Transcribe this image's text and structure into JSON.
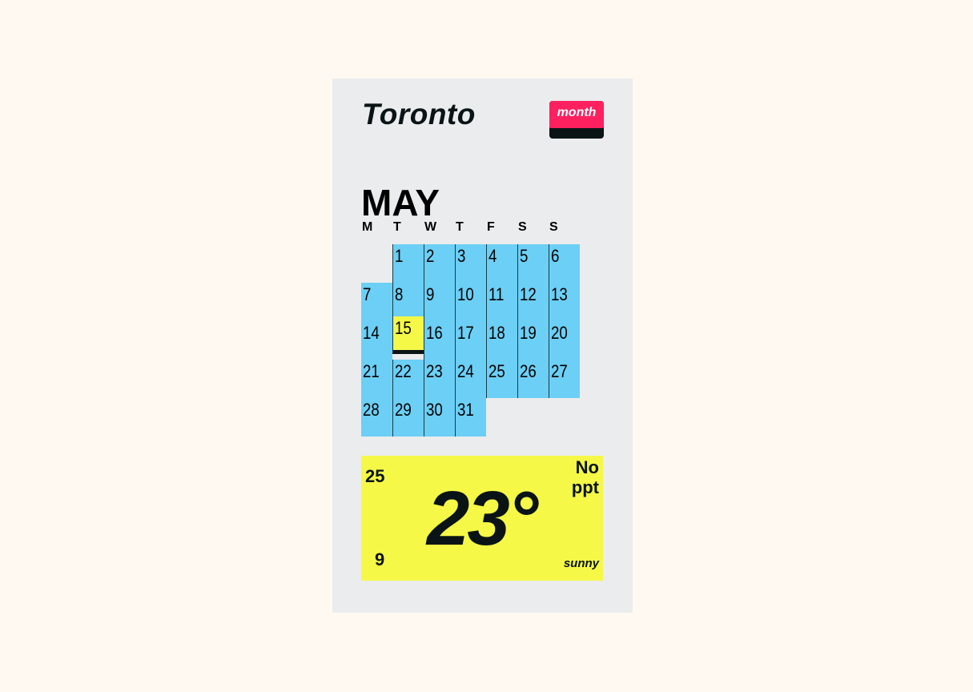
{
  "header": {
    "city": "Toronto",
    "view_button": "month"
  },
  "calendar": {
    "month": "MAY",
    "weekdays": [
      "M",
      "T",
      "W",
      "T",
      "F",
      "S",
      "S"
    ],
    "first_weekday_index": 1,
    "days": 31,
    "today": 15
  },
  "weather": {
    "high": "25",
    "low": "9",
    "temperature": "23°",
    "precipitation_line1": "No",
    "precipitation_line2": "ppt",
    "condition": "sunny"
  },
  "colors": {
    "background": "#fff9f2",
    "card": "#ebeced",
    "day_cell": "#6ccff5",
    "today": "#f5f847",
    "accent": "#ff2060",
    "ink": "#0a1416"
  }
}
